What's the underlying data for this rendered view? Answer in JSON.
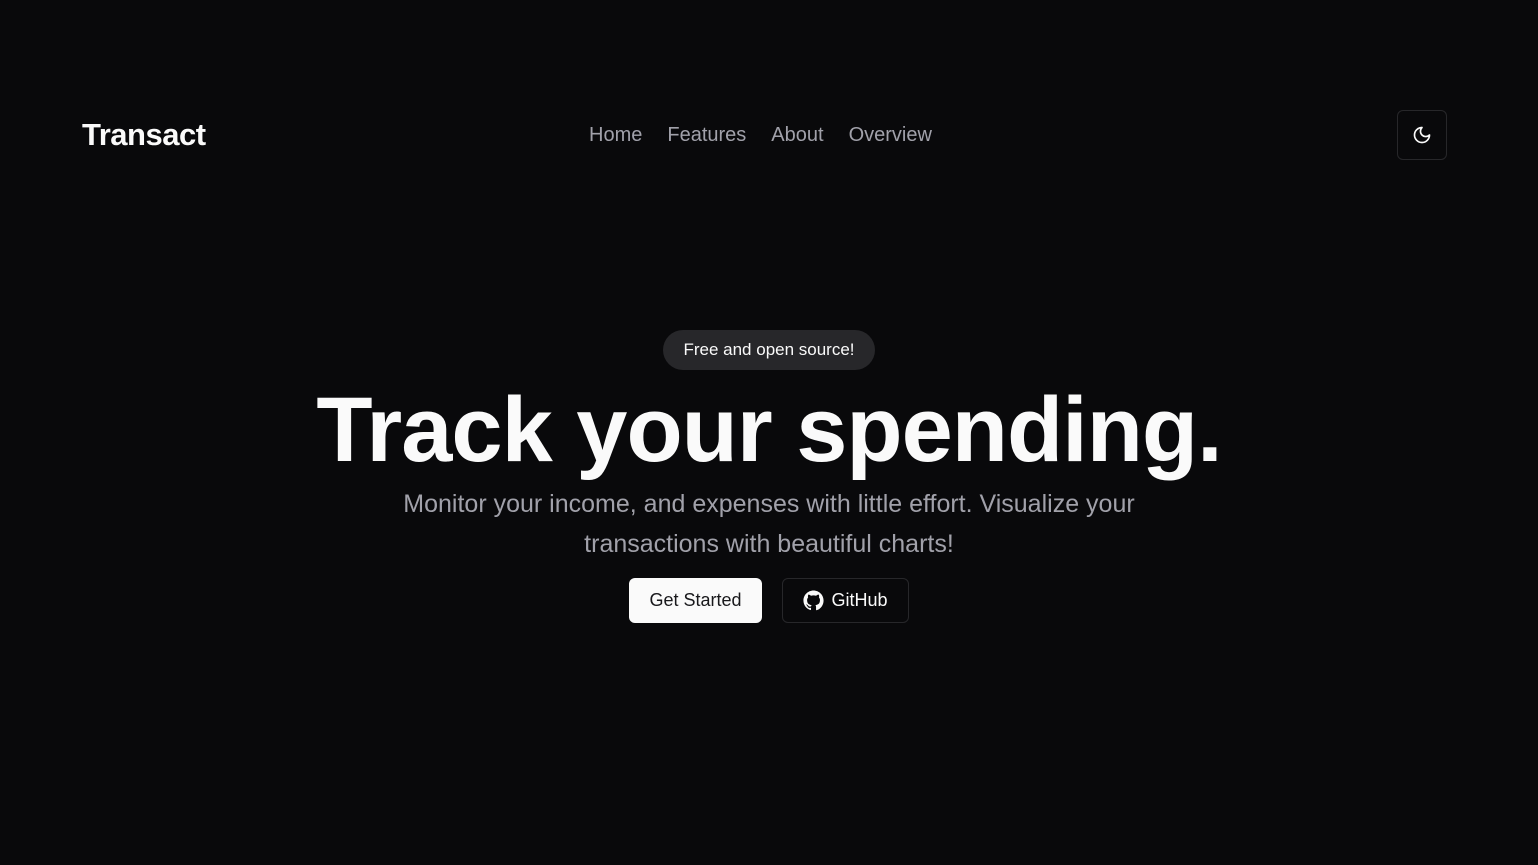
{
  "header": {
    "brand": "Transact",
    "nav": [
      {
        "label": "Home"
      },
      {
        "label": "Features"
      },
      {
        "label": "About"
      },
      {
        "label": "Overview"
      }
    ],
    "theme_toggle_icon": "moon-icon"
  },
  "hero": {
    "badge": "Free and open source!",
    "headline": "Track your spending.",
    "subtext": "Monitor your income, and expenses with little effort. Visualize your transactions with beautiful charts!",
    "primary_button": "Get Started",
    "secondary_button": "GitHub",
    "secondary_button_icon": "github-icon"
  },
  "colors": {
    "background": "#09090b",
    "foreground": "#fafafa",
    "muted": "#a1a1aa",
    "border": "#27272a",
    "badge_bg": "#27272a"
  }
}
